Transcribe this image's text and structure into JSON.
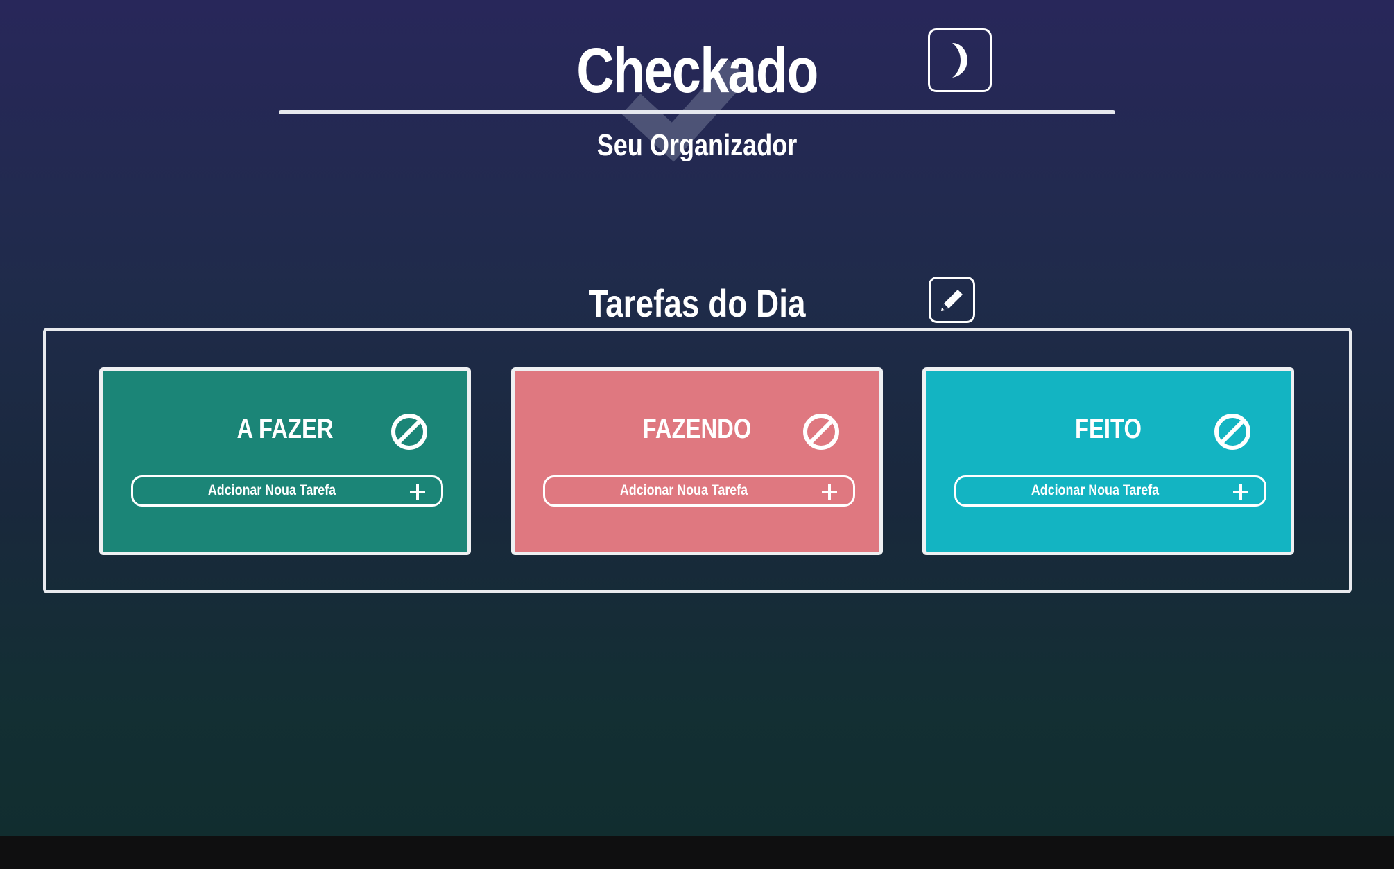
{
  "header": {
    "title": "Checkado",
    "subtitle": "Seu Organizador",
    "theme_toggle_icon": "moon-icon"
  },
  "section": {
    "title": "Tarefas do Dia",
    "edit_icon": "pencil-icon"
  },
  "columns": [
    {
      "title": "A FAZER",
      "add_label": "Adcionar Noua Tarefa",
      "color": "#1b8577",
      "clear_icon": "block-icon",
      "add_icon": "plus-icon"
    },
    {
      "title": "FAZENDO",
      "add_label": "Adcionar Noua Tarefa",
      "color": "#df7880",
      "clear_icon": "block-icon",
      "add_icon": "plus-icon"
    },
    {
      "title": "FEITO",
      "add_label": "Adcionar Noua Tarefa",
      "color": "#13b4c2",
      "clear_icon": "block-icon",
      "add_icon": "plus-icon"
    }
  ],
  "colors": {
    "background_top": "#28275a",
    "background_bottom": "#112d2f",
    "border": "#e8eaee"
  }
}
